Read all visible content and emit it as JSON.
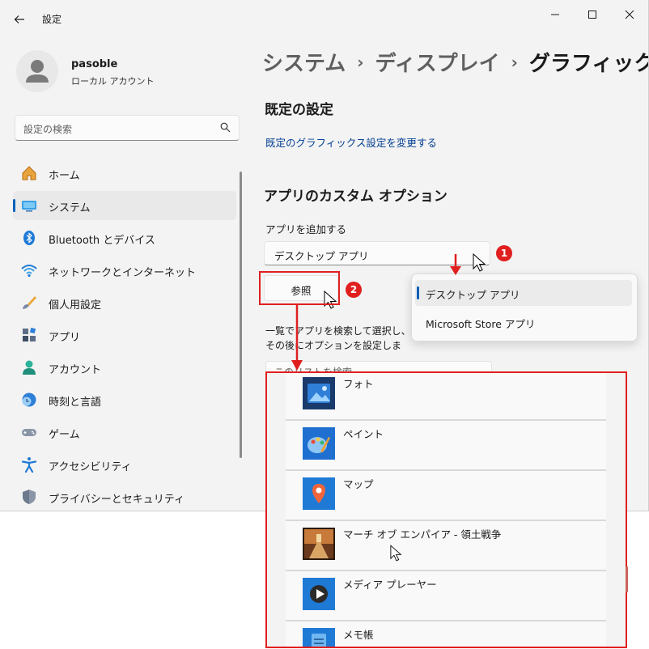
{
  "window": {
    "title": "設定"
  },
  "profile": {
    "name": "pasoble",
    "account_type": "ローカル アカウント"
  },
  "sidebar": {
    "search_placeholder": "設定の検索",
    "items": [
      {
        "label": "ホーム",
        "icon": "home-icon"
      },
      {
        "label": "システム",
        "icon": "system-icon",
        "selected": true
      },
      {
        "label": "Bluetooth とデバイス",
        "icon": "bluetooth-icon"
      },
      {
        "label": "ネットワークとインターネット",
        "icon": "wifi-icon"
      },
      {
        "label": "個人用設定",
        "icon": "brush-icon"
      },
      {
        "label": "アプリ",
        "icon": "apps-icon"
      },
      {
        "label": "アカウント",
        "icon": "account-icon"
      },
      {
        "label": "時刻と言語",
        "icon": "clock-icon"
      },
      {
        "label": "ゲーム",
        "icon": "gamepad-icon"
      },
      {
        "label": "アクセシビリティ",
        "icon": "accessibility-icon"
      },
      {
        "label": "プライバシーとセキュリティ",
        "icon": "shield-icon"
      }
    ]
  },
  "breadcrumb": {
    "part1": "システム",
    "part2": "ディスプレイ",
    "current": "グラフィック",
    "separator": "›"
  },
  "defaults": {
    "heading": "既定の設定",
    "link": "既定のグラフィックス設定を変更する"
  },
  "custom": {
    "heading": "アプリのカスタム オプション",
    "add_label": "アプリを追加する",
    "combo_value": "デスクトップ アプリ",
    "browse_label": "参照",
    "description": "一覧でアプリを検索して選択し、その後にオプションを設定します。変更を有効にするには、アプリの再起動が必要になる場合があります。",
    "list_search_placeholder": "このリストを検索"
  },
  "dropdown": {
    "options": [
      {
        "label": "デスクトップ アプリ",
        "selected": true
      },
      {
        "label": "Microsoft Store アプリ",
        "selected": false
      }
    ]
  },
  "annotations": {
    "step1": "1",
    "step2": "2",
    "color": "#e0201f"
  },
  "apps": [
    {
      "name": "フォト",
      "icon": "photos-icon"
    },
    {
      "name": "ペイント",
      "icon": "paint-icon"
    },
    {
      "name": "マップ",
      "icon": "maps-icon"
    },
    {
      "name": "マーチ オブ エンパイア - 領土戦争",
      "icon": "game-thumbnail-icon"
    },
    {
      "name": "メディア プレーヤー",
      "icon": "media-player-icon"
    },
    {
      "name": "メモ帳",
      "icon": "notepad-icon"
    }
  ],
  "colors": {
    "accent": "#005fb8",
    "link": "#003e92",
    "annotation": "#e0201f",
    "background": "#f3f3f3"
  }
}
